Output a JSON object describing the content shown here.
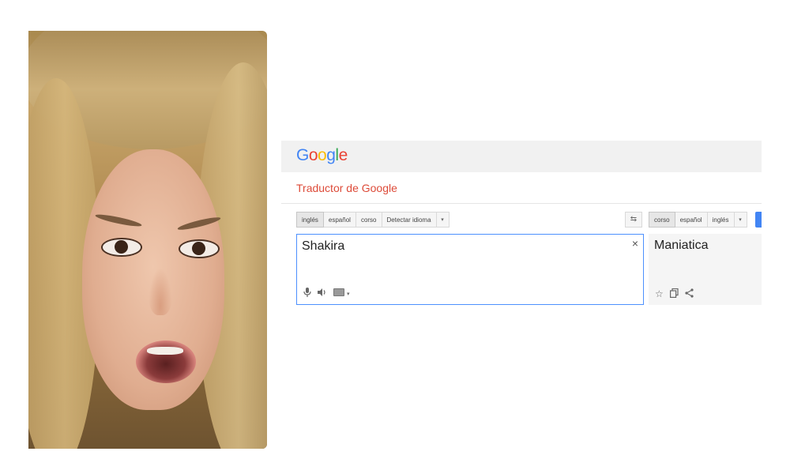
{
  "header": {
    "logo_letters": [
      {
        "ch": "G",
        "color": "#4285f4"
      },
      {
        "ch": "o",
        "color": "#ea4335"
      },
      {
        "ch": "o",
        "color": "#fbbc05"
      },
      {
        "ch": "g",
        "color": "#4285f4"
      },
      {
        "ch": "l",
        "color": "#34a853"
      },
      {
        "ch": "e",
        "color": "#ea4335"
      }
    ],
    "app_title": "Traductor de Google"
  },
  "source_langs": [
    "inglés",
    "español",
    "corso",
    "Detectar idioma"
  ],
  "target_langs": [
    "corso",
    "español",
    "inglés"
  ],
  "source": {
    "text": "Shakira",
    "clear_icon": "×",
    "tool_icons": [
      "microphone-icon",
      "speaker-icon",
      "keyboard-icon"
    ]
  },
  "target": {
    "text": "Maniatica",
    "tool_icons": [
      "star-icon",
      "copy-icon",
      "share-icon"
    ]
  },
  "colors": {
    "header_bg": "#f1f1f1",
    "title_red": "#dd4b39",
    "focus_blue": "#4d90fe",
    "translate_blue": "#4285f4"
  }
}
